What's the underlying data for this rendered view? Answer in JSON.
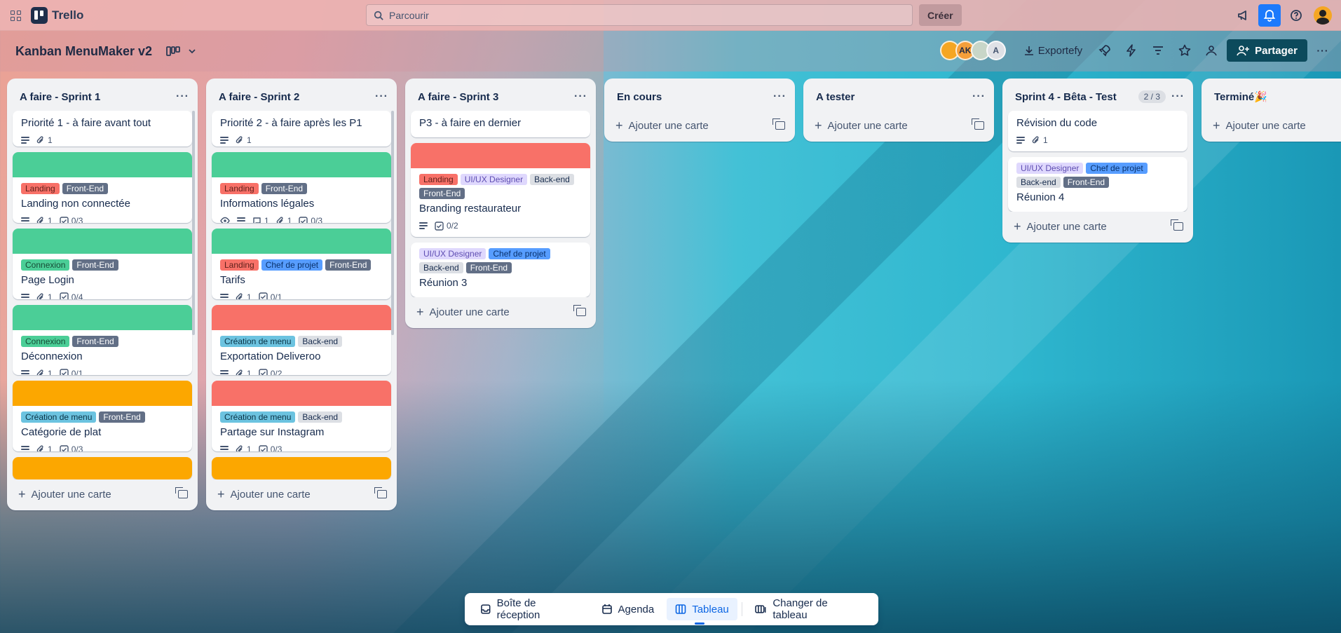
{
  "topbar": {
    "app_name": "Trello",
    "search_placeholder": "Parcourir",
    "create_label": "Créer"
  },
  "board": {
    "title": "Kanban MenuMaker v2",
    "members": [
      "",
      "AK",
      "",
      "A"
    ],
    "export_label": "Exportefy",
    "share_label": "Partager"
  },
  "label_colors": {
    "Landing": {
      "bg": "#f87168",
      "fg": "#5d1f1a"
    },
    "Front-End": {
      "bg": "#626f86",
      "fg": "#ffffff"
    },
    "Connexion": {
      "bg": "#4bce97",
      "fg": "#164b35"
    },
    "Création de menu": {
      "bg": "#6cc3e0",
      "fg": "#0a3346"
    },
    "UI/UX Designer": {
      "bg": "#dfd8fd",
      "fg": "#5e4db2"
    },
    "Back-end": {
      "bg": "#dcdfe4",
      "fg": "#172b4d"
    },
    "Chef de projet": {
      "bg": "#579dff",
      "fg": "#09326c"
    }
  },
  "lists": [
    {
      "title": "A faire - Sprint 1",
      "count": "",
      "add_card": "Ajouter une carte",
      "scroll": true,
      "cards": [
        {
          "cover": "",
          "labels": [],
          "title": "Priorité 1 - à faire avant tout",
          "badges": {
            "desc": true,
            "attach": "1"
          }
        },
        {
          "cover": "#4bce97",
          "labels": [
            "Landing",
            "Front-End"
          ],
          "title": "Landing non connectée",
          "badges": {
            "desc": true,
            "attach": "1",
            "check": "0/3"
          }
        },
        {
          "cover": "#4bce97",
          "labels": [
            "Connexion",
            "Front-End"
          ],
          "title": "Page Login",
          "badges": {
            "desc": true,
            "attach": "1",
            "check": "0/4"
          }
        },
        {
          "cover": "#4bce97",
          "labels": [
            "Connexion",
            "Front-End"
          ],
          "title": "Déconnexion",
          "badges": {
            "desc": true,
            "attach": "1",
            "check": "0/1"
          }
        },
        {
          "cover": "#fca700",
          "labels": [
            "Création de menu",
            "Front-End"
          ],
          "title": "Catégorie de plat",
          "badges": {
            "desc": true,
            "attach": "1",
            "check": "0/3"
          }
        },
        {
          "cover": "#fca700",
          "labels": [],
          "title": "",
          "badges": {}
        }
      ]
    },
    {
      "title": "A faire - Sprint 2",
      "count": "",
      "add_card": "Ajouter une carte",
      "scroll": true,
      "cards": [
        {
          "cover": "",
          "labels": [],
          "title": "Priorité 2 - à faire après les P1",
          "badges": {
            "desc": true,
            "attach": "1"
          }
        },
        {
          "cover": "#4bce97",
          "labels": [
            "Landing",
            "Front-End"
          ],
          "title": "Informations légales",
          "badges": {
            "watch": true,
            "desc": true,
            "comments": "1",
            "attach": "1",
            "check": "0/3"
          }
        },
        {
          "cover": "#4bce97",
          "labels": [
            "Landing",
            "Chef de projet",
            "Front-End"
          ],
          "title": "Tarifs",
          "badges": {
            "desc": true,
            "attach": "1",
            "check": "0/1"
          }
        },
        {
          "cover": "#f87168",
          "labels": [
            "Création de menu",
            "Back-end"
          ],
          "title": "Exportation Deliveroo",
          "badges": {
            "desc": true,
            "attach": "1",
            "check": "0/2"
          }
        },
        {
          "cover": "#f87168",
          "labels": [
            "Création de menu",
            "Back-end"
          ],
          "title": "Partage sur Instagram",
          "badges": {
            "desc": true,
            "attach": "1",
            "check": "0/3"
          }
        },
        {
          "cover": "#fca700",
          "labels": [],
          "title": "",
          "badges": {}
        }
      ]
    },
    {
      "title": "A faire - Sprint 3",
      "count": "",
      "add_card": "Ajouter une carte",
      "scroll": false,
      "cards": [
        {
          "cover": "",
          "labels": [],
          "title": "P3 - à faire en dernier",
          "badges": {}
        },
        {
          "cover": "#f87168",
          "labels": [
            "Landing",
            "UI/UX Designer",
            "Back-end",
            "Front-End"
          ],
          "title": "Branding restaurateur",
          "badges": {
            "desc": true,
            "check": "0/2"
          }
        },
        {
          "cover": "",
          "labels": [
            "UI/UX Designer",
            "Chef de projet",
            "Back-end",
            "Front-End"
          ],
          "title": "Réunion 3",
          "badges": {}
        }
      ]
    },
    {
      "title": "En cours",
      "count": "",
      "add_card": "Ajouter une carte",
      "scroll": false,
      "cards": []
    },
    {
      "title": "A tester",
      "count": "",
      "add_card": "Ajouter une carte",
      "scroll": false,
      "cards": []
    },
    {
      "title": "Sprint 4 - Bêta - Test",
      "count": "2 / 3",
      "add_card": "Ajouter une carte",
      "scroll": false,
      "cards": [
        {
          "cover": "",
          "labels": [],
          "title": "Révision du code",
          "badges": {
            "desc": true,
            "attach": "1"
          }
        },
        {
          "cover": "",
          "labels": [
            "UI/UX Designer",
            "Chef de projet",
            "Back-end",
            "Front-End"
          ],
          "title": "Réunion 4",
          "badges": {}
        }
      ]
    },
    {
      "title": "Terminé🎉",
      "count": "",
      "add_card": "Ajouter une carte",
      "scroll": false,
      "cards": []
    }
  ],
  "switcher": {
    "inbox": "Boîte de réception",
    "agenda": "Agenda",
    "board": "Tableau",
    "switch": "Changer de tableau"
  }
}
